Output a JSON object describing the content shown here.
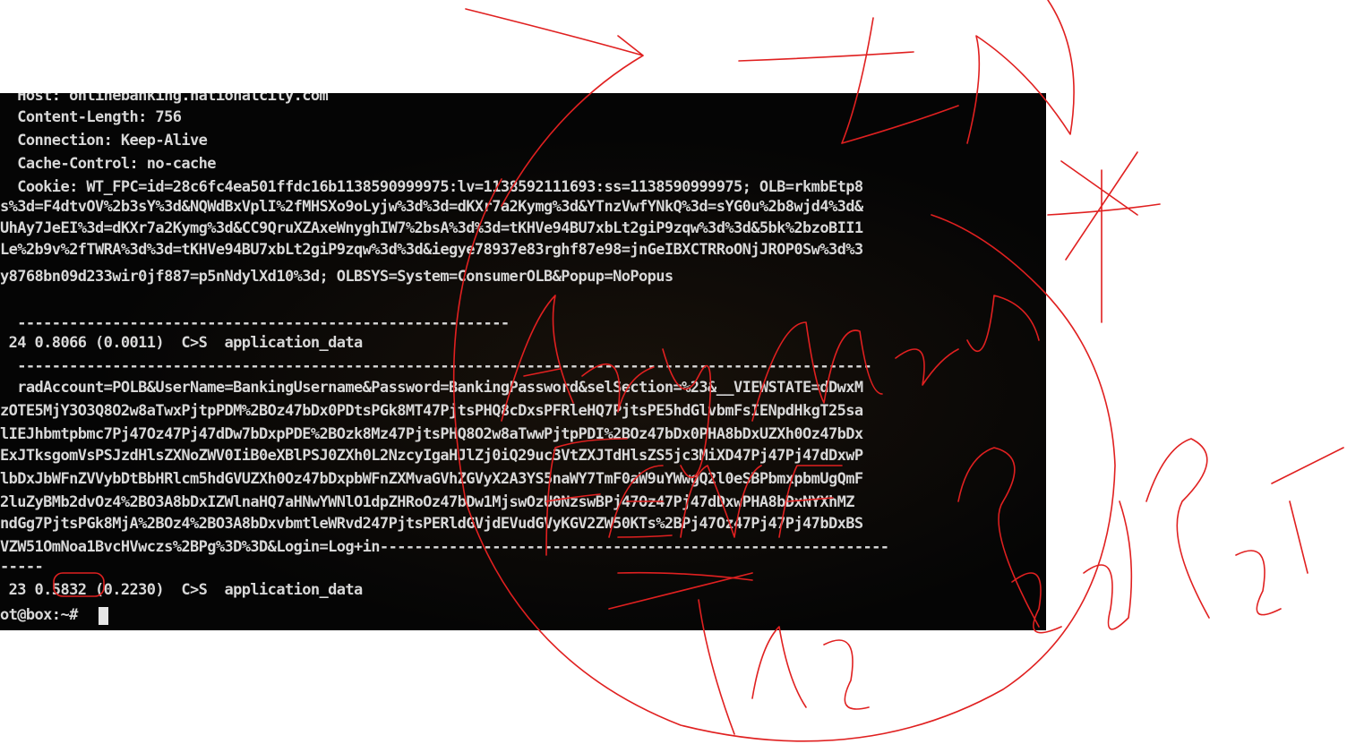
{
  "terminal": {
    "lines": [
      "  Host: onlinebanking.nationalcity.com",
      "  Content-Length: 756",
      "  Connection: Keep-Alive",
      "  Cache-Control: no-cache",
      "  Cookie: WT_FPC=id=28c6fc4ea501ffdc16b1138590999975:lv=1138592111693:ss=1138590999975; OLB=rkmbEtp8",
      "s%3d=F4dtvOV%2b3sY%3d&NQWdBxVplI%2fMHSXo9oLyjw%3d%3d=dKXr7a2Kymg%3d&YTnzVwfYNkQ%3d=sYG0u%2b8wjd4%3d&",
      "UhAy7JeEI%3d=dKXr7a2Kymg%3d&CC9QruXZAxeWnyghIW7%2bsA%3d%3d=tKHVe94BU7xbLt2giP9zqw%3d%3d&5bk%2bzoBII1",
      "Le%2b9v%2fTWRA%3d%3d=tKHVe94BU7xbLt2giP9zqw%3d%3d&iegye78937e83rghf87e98=jnGeIBXCTRRoONjJROP0Sw%3d%3",
      "y8768bn09d233wir0jf887=p5nNdylXd10%3d; OLBSYS=System=ConsumerOLB&Popup=NoPopus",
      "",
      "  ---------------------------------------------------------",
      " 24 0.8066 (0.0011)  C>S  application_data",
      "  ---------------------------------------------------------------------------------------------------",
      "  radAccount=POLB&UserName=BankingUsername&Password=BankingPassword&selSection=%23&__VIEWSTATE=dDwxM",
      "zOTE5MjY3O3Q8O2w8aTwxPjtpPDM%2BOz47bDx0PDtsPGk8MT47PjtsPHQ8cDxsPFRleHQ7PjtsPE5hdGlvbmFsIENpdHkgT25sa",
      "lIEJhbmtpbmc7Pj47Oz47Pj47dDw7bDxpPDE%2BOzk8Mz47PjtsPHQ8O2w8aTwwPjtpPDI%2BOz47bDx0PHA8bDxUZXh0Oz47bDx",
      "ExJTksgomVsPSJzdHlsZXNoZWV0IiB0eXBlPSJ0ZXh0L2NzcyIgaHJlZj0iQ29uc3VtZXJTdHlsZS5jc3MiXD47Pj47Pj47dDxwP",
      "lbDxJbWFnZVVybDtBbHRlcm5hdGVUZXh0Oz47bDxpbWFnZXMvaGVhZGVyX2A3YS5naWY7TmF0aW9uYWwgQ2l0eSBPbmxpbmUgQmF",
      "2luZyBMb2dvOz4%2BO3A8bDxIZWlnaHQ7aHNwYWNlO1dpZHRoOz47bDw1MjswOzU0NzswBPj47Oz47Pj47dDxwPHA8bDxNYXhMZ",
      "ndGg7PjtsPGk8MjA%2BOz4%2BO3A8bDxvbmtleWRvd247PjtsPERldGVjdEVudGVyKGV2ZW50KTs%2BPj47Oz47Pj47Pj47bDxBS",
      "VZW51OmNoa1BvcHVwczs%2BPg%3D%3D&Login=Log+in-----------------------------------------------------------",
      "-----",
      " 23 0.5832 (0.2230)  C>S  application_data",
      "ot@box:~# "
    ]
  },
  "annotation": {
    "handwriting": [
      "Aay Man",
      "FENF",
      "The Red Pot"
    ],
    "stroke_color": "#e02020"
  }
}
